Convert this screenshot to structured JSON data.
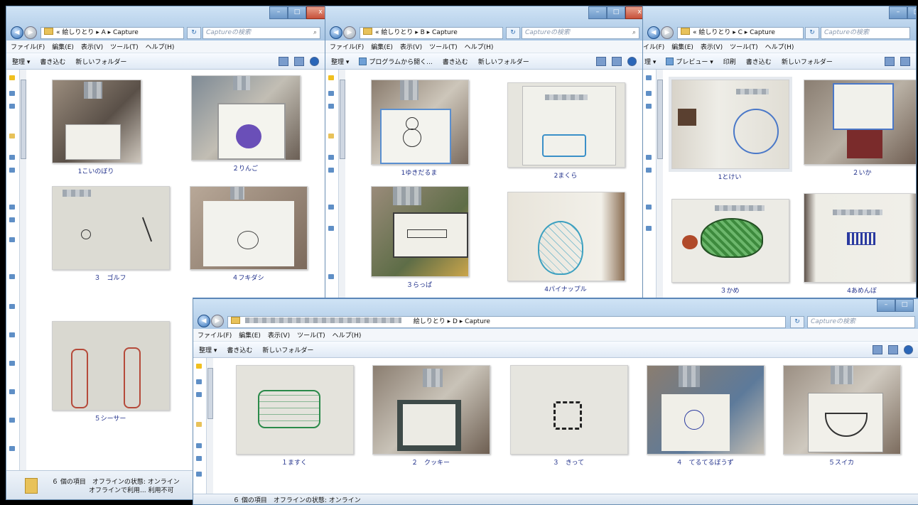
{
  "common": {
    "menu": [
      "ファイル(F)",
      "編集(E)",
      "表示(V)",
      "ツール(T)",
      "ヘルプ(H)"
    ],
    "search_placeholder": "Captureの検索",
    "back_glyph": "◀",
    "forward_glyph": "▶",
    "refresh_glyph": "↻",
    "minimize_glyph": "–",
    "maximize_glyph": "□",
    "close_glyph": "x"
  },
  "windows": {
    "a": {
      "address": "« 絵しりとり ▸ A ▸ Capture",
      "toolbar": [
        "整理 ▾",
        "書き込む",
        "新しいフォルダー"
      ],
      "items": [
        "1こいのぼり",
        "２りんご",
        "３　ゴルフ",
        "４フキダシ",
        "５シーサー"
      ],
      "status_line1": "６ 個の項目　オフラインの状態: オンライン",
      "status_line2": "オフラインで利用... 利用不可"
    },
    "b": {
      "address": "« 絵しりとり ▸ B ▸ Capture",
      "toolbar": [
        "整理 ▾",
        "プログラムから開く...",
        "書き込む",
        "新しいフォルダー"
      ],
      "items": [
        "1ゆきだるま",
        "2まくら",
        "３らっぱ",
        "4パイナップル"
      ]
    },
    "c": {
      "address": "« 絵しりとり ▸ C ▸ Capture",
      "toolbar": [
        "理 ▾",
        "プレビュー ▾",
        "印刷",
        "書き込む",
        "新しいフォルダー"
      ],
      "menu_first": "イル(F)",
      "items": [
        "1とけい",
        "２いか",
        "３かめ",
        "4あめんぼ"
      ]
    },
    "d": {
      "address": "絵しりとり ▸ D ▸ Capture",
      "toolbar": [
        "整理 ▾",
        "書き込む",
        "新しいフォルダー"
      ],
      "items": [
        "１ますく",
        "２　クッキー",
        "３　きって",
        "４　てるてるぼうず",
        "５スイカ"
      ],
      "status_line1": "６ 個の項目　オフラインの状態: オンライン"
    }
  },
  "colors": {
    "title_bar": "#a9c6e4",
    "caption": "#1f2f8a",
    "selection": "#e5e9ee"
  }
}
